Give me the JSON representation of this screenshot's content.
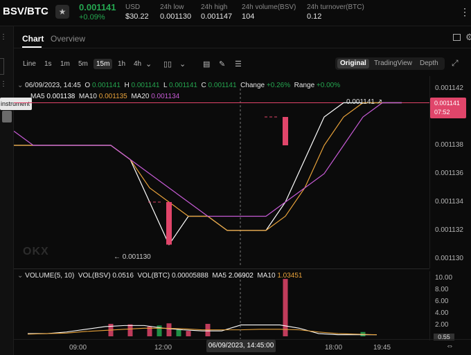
{
  "header": {
    "pair": "BSV/BTC",
    "last_price": "0.001141",
    "change_pct": "+0.09%",
    "stats": [
      {
        "label": "USD",
        "value": "$30.22"
      },
      {
        "label": "24h low",
        "value": "0.001130"
      },
      {
        "label": "24h high",
        "value": "0.001147"
      },
      {
        "label": "24h volume(BSV)",
        "value": "104"
      },
      {
        "label": "24h turnover(BTC)",
        "value": "0.12"
      }
    ]
  },
  "left": {
    "tooltip": "instrument"
  },
  "tabs": {
    "chart": "Chart",
    "overview": "Overview"
  },
  "toolbar": {
    "timeframes": [
      "Line",
      "1s",
      "1m",
      "5m",
      "15m",
      "1h",
      "4h"
    ],
    "active_timeframe": "15m",
    "views": [
      "Original",
      "TradingView",
      "Depth"
    ],
    "active_view": "Original"
  },
  "ohlc": {
    "datetime": "06/09/2023, 14:45",
    "o_label": "O",
    "o": "0.001141",
    "h_label": "H",
    "h": "0.001141",
    "l_label": "L",
    "l": "0.001141",
    "c_label": "C",
    "c": "0.001141",
    "change_label": "Change",
    "change": "+0.26%",
    "range_label": "Range",
    "range": "+0.00%"
  },
  "ma": {
    "ma5_label": "MA5",
    "ma5": "0.001138",
    "ma10_label": "MA10",
    "ma10": "0.001135",
    "ma20_label": "MA20",
    "ma20": "0.001134"
  },
  "volume_info": {
    "label": "VOLUME(5, 10)",
    "vol_bsv_label": "VOL(BSV)",
    "vol_bsv": "0.0516",
    "vol_btc_label": "VOL(BTC)",
    "vol_btc": "0.00005888",
    "ma5_label": "MA5",
    "ma5": "2.06902",
    "ma10_label": "MA10",
    "ma10": "1.03451"
  },
  "price_axis": [
    "0.001142",
    "0.001140",
    "0.001138",
    "0.001136",
    "0.001134",
    "0.001132",
    "0.001130"
  ],
  "price_badge": {
    "price": "0.001141",
    "countdown": "07:52"
  },
  "last_line_label": "0.001141",
  "low_label": "0.001130",
  "volume_axis": [
    "10.00",
    "8.00",
    "6.00",
    "4.00",
    "2.00"
  ],
  "volume_badge": "0.55",
  "time_axis": [
    "09:00",
    "12:00",
    "18:00",
    "19:45"
  ],
  "time_cursor": "06/09/2023, 14:45:00",
  "watermark": "OKX",
  "colors": {
    "up": "#25a750",
    "down": "#e0456a",
    "ma5": "#ffffff",
    "ma10": "#e8a23a",
    "ma20": "#c75bd6"
  },
  "chart_data": {
    "type": "line",
    "title": "",
    "y_range": [
      0.00113,
      0.001142
    ],
    "series": [
      {
        "name": "MA5",
        "values": [
          0.001138,
          0.001138,
          0.001138,
          0.001138,
          0.001138,
          0.001138,
          0.001137,
          0.001134,
          0.001131,
          0.001133,
          0.001133,
          0.001132,
          0.001132,
          0.001132,
          0.001134,
          0.001137,
          0.00114,
          0.001141,
          0.001141,
          0.001141,
          0.001141
        ]
      },
      {
        "name": "MA10",
        "values": [
          0.001138,
          0.001138,
          0.001138,
          0.001138,
          0.001138,
          0.001138,
          0.001137,
          0.001135,
          0.001134,
          0.001133,
          0.001133,
          0.001132,
          0.001132,
          0.001132,
          0.001133,
          0.001135,
          0.001138,
          0.00114,
          0.001141,
          0.001141,
          0.001141
        ]
      },
      {
        "name": "MA20",
        "values": [
          0.001139,
          0.001138,
          0.001138,
          0.001138,
          0.001138,
          0.001138,
          0.001137,
          0.001136,
          0.001135,
          0.001134,
          0.001133,
          0.001133,
          0.001133,
          0.001133,
          0.001134,
          0.001135,
          0.001136,
          0.001138,
          0.00114,
          0.001141,
          0.001141
        ]
      }
    ],
    "candles": [
      {
        "index": 8,
        "open": 0.001134,
        "close": 0.001131,
        "high": 0.001134,
        "low": 0.001131
      },
      {
        "index": 14,
        "open": 0.00114,
        "close": 0.001138,
        "high": 0.00114,
        "low": 0.001138
      }
    ]
  },
  "volume_chart": {
    "y_range": [
      0,
      11
    ],
    "bars": [
      {
        "index": 5,
        "value": 2.3,
        "dir": "down"
      },
      {
        "index": 6,
        "value": 2.2,
        "dir": "down"
      },
      {
        "index": 7,
        "value": 1.8,
        "dir": "down"
      },
      {
        "index": 7.5,
        "value": 2.0,
        "dir": "up"
      },
      {
        "index": 8,
        "value": 2.4,
        "dir": "down"
      },
      {
        "index": 8.5,
        "value": 1.2,
        "dir": "up"
      },
      {
        "index": 9,
        "value": 1.0,
        "dir": "down"
      },
      {
        "index": 10,
        "value": 2.3,
        "dir": "down"
      },
      {
        "index": 14,
        "value": 10.6,
        "dir": "down"
      },
      {
        "index": 18,
        "value": 0.8,
        "dir": "up"
      }
    ],
    "ma5": [
      0.5,
      0.5,
      0.8,
      1.3,
      1.8,
      2.0,
      2.0,
      1.5,
      1.2,
      1.0,
      1.0,
      2.1,
      2.1,
      2.1,
      1.5,
      0.5,
      0.3,
      0.3,
      0.3
    ],
    "ma10": [
      0.4,
      0.5,
      0.6,
      0.9,
      1.1,
      1.3,
      1.5,
      1.5,
      1.4,
      1.2,
      1.2,
      1.2,
      1.3,
      1.3,
      1.2,
      0.8,
      0.5,
      0.4,
      0.3
    ]
  }
}
